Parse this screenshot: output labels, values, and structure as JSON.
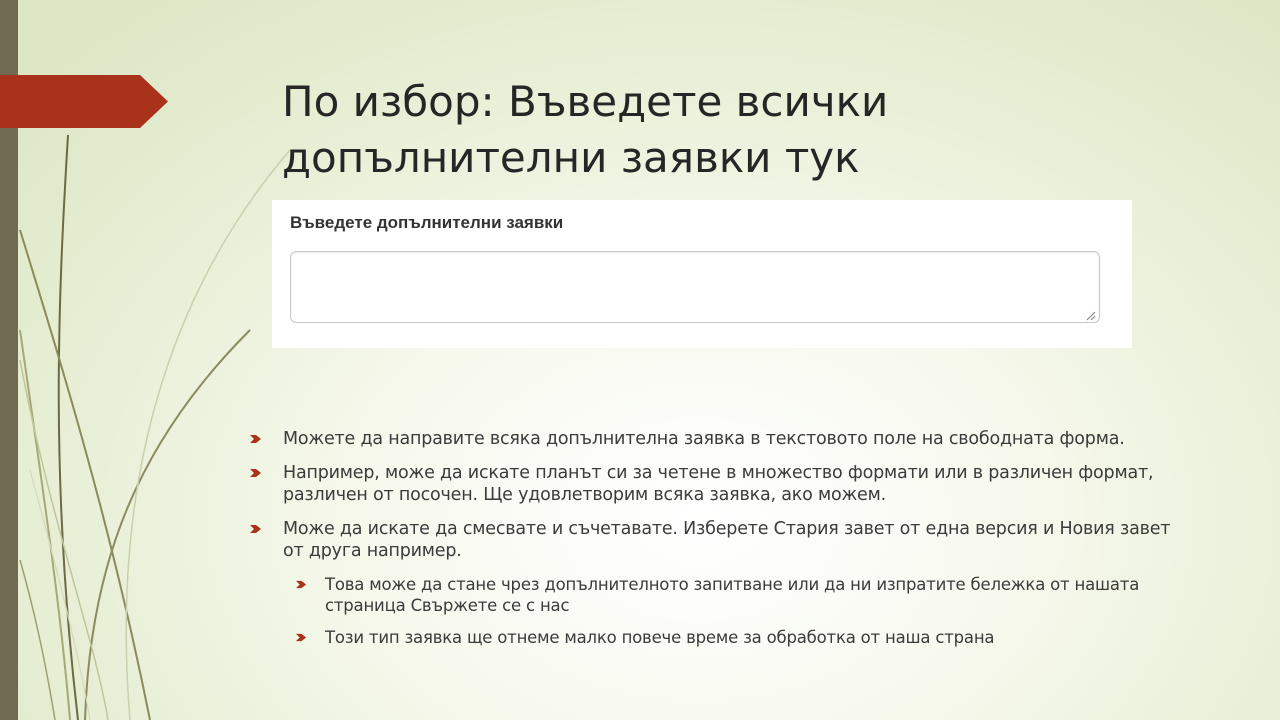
{
  "slide": {
    "title_lines": [
      "По избор: Въведете всички",
      "допълнителни заявки тук"
    ]
  },
  "form": {
    "label": "Въведете допълнителни заявки",
    "textarea_value": ""
  },
  "bullets": [
    {
      "text": "Можете да направите всяка допълнителна заявка в текстовото поле на свободната форма.",
      "level": 1
    },
    {
      "text": "Например, може да искате планът си за четене в множество формати или в различен формат, различен от посочен.  Ще удовлетворим всяка заявка, ако можем.",
      "level": 1
    },
    {
      "text": "Може да искате да смесвате и съчетавате.  Изберете Стария завет от една версия и Новия завет от друга например.",
      "level": 1
    },
    {
      "text": "Това може да стане чрез допълнителното запитване или да ни изпратите бележка от нашата страница Свържете се с нас",
      "level": 2
    },
    {
      "text": "Този тип заявка ще отнеме малко повече време за обработка от наша страна",
      "level": 2
    }
  ],
  "colors": {
    "accent": "#a8321a",
    "sidebar": "#6f6a50",
    "text": "#3b3b3b"
  }
}
